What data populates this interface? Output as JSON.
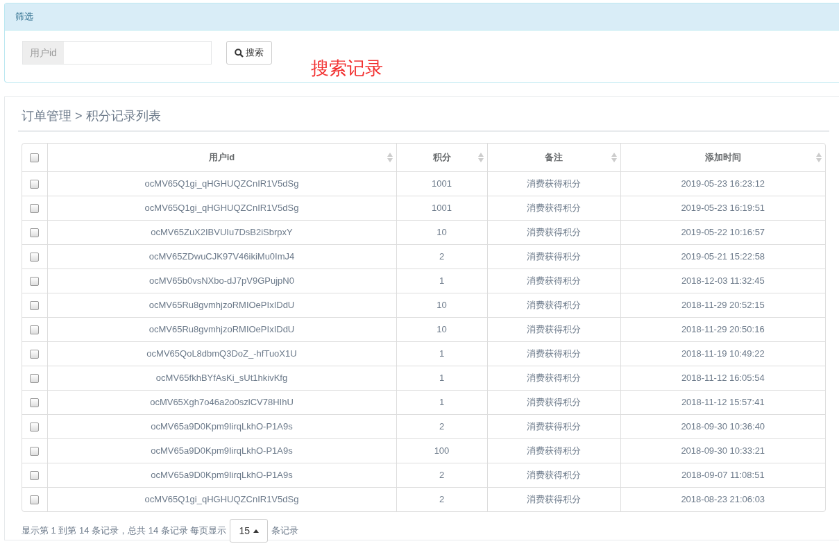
{
  "filter_panel": {
    "title": "筛选",
    "field": {
      "label": "用户id"
    },
    "search_button": "搜索",
    "annotation": "搜索记录"
  },
  "list_panel": {
    "breadcrumb": "订单管理 > 积分记录列表",
    "table": {
      "select_all_checked": false,
      "columns": [
        "用户id",
        "积分",
        "备注",
        "添加时间"
      ],
      "rows": [
        {
          "checked": false,
          "cells": [
            "ocMV65Q1gi_qHGHUQZCnIR1V5dSg",
            "1001",
            "消费获得积分",
            "2019-05-23 16:23:12"
          ]
        },
        {
          "checked": false,
          "cells": [
            "ocMV65Q1gi_qHGHUQZCnIR1V5dSg",
            "1001",
            "消费获得积分",
            "2019-05-23 16:19:51"
          ]
        },
        {
          "checked": false,
          "cells": [
            "ocMV65ZuX2IBVUIu7DsB2iSbrpxY",
            "10",
            "消费获得积分",
            "2019-05-22 10:16:57"
          ]
        },
        {
          "checked": false,
          "cells": [
            "ocMV65ZDwuCJK97V46ikiMu0ImJ4",
            "2",
            "消费获得积分",
            "2019-05-21 15:22:58"
          ]
        },
        {
          "checked": false,
          "cells": [
            "ocMV65b0vsNXbo-dJ7pV9GPujpN0",
            "1",
            "消费获得积分",
            "2018-12-03 11:32:45"
          ]
        },
        {
          "checked": false,
          "cells": [
            "ocMV65Ru8gvmhjzoRMIOePIxIDdU",
            "10",
            "消费获得积分",
            "2018-11-29 20:52:15"
          ]
        },
        {
          "checked": false,
          "cells": [
            "ocMV65Ru8gvmhjzoRMIOePIxIDdU",
            "10",
            "消费获得积分",
            "2018-11-29 20:50:16"
          ]
        },
        {
          "checked": false,
          "cells": [
            "ocMV65QoL8dbmQ3DoZ_-hfTuoX1U",
            "1",
            "消费获得积分",
            "2018-11-19 10:49:22"
          ]
        },
        {
          "checked": false,
          "cells": [
            "ocMV65fkhBYfAsKi_sUt1hkivKfg",
            "1",
            "消费获得积分",
            "2018-11-12 16:05:54"
          ]
        },
        {
          "checked": false,
          "cells": [
            "ocMV65Xgh7o46a2o0szlCV78HIhU",
            "1",
            "消费获得积分",
            "2018-11-12 15:57:41"
          ]
        },
        {
          "checked": false,
          "cells": [
            "ocMV65a9D0Kpm9IirqLkhO-P1A9s",
            "2",
            "消费获得积分",
            "2018-09-30 10:36:40"
          ]
        },
        {
          "checked": false,
          "cells": [
            "ocMV65a9D0Kpm9IirqLkhO-P1A9s",
            "100",
            "消费获得积分",
            "2018-09-30 10:33:21"
          ]
        },
        {
          "checked": false,
          "cells": [
            "ocMV65a9D0Kpm9IirqLkhO-P1A9s",
            "2",
            "消费获得积分",
            "2018-09-07 11:08:51"
          ]
        },
        {
          "checked": false,
          "cells": [
            "ocMV65Q1gi_qHGHUQZCnIR1V5dSg",
            "2",
            "消费获得积分",
            "2018-08-23 21:06:03"
          ]
        }
      ]
    },
    "pagination": {
      "summary": "显示第 1 到第 14 条记录，总共 14 条记录 每页显示",
      "page_size": "15",
      "suffix": "条记录"
    }
  }
}
